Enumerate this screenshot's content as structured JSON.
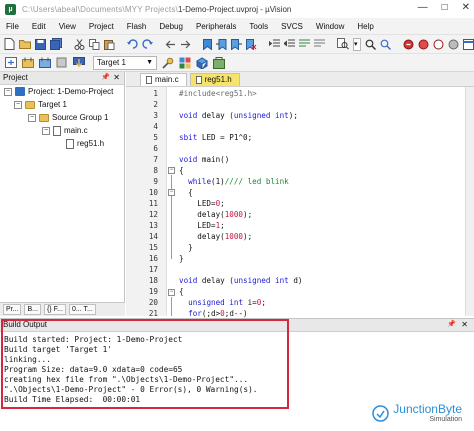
{
  "window": {
    "title_prefix": "C:\\Users\\abeal\\Documents\\MYY Projects\\",
    "title_main": "1-Demo-Project.uvproj - µVision",
    "controls": [
      "—",
      "□",
      "✕"
    ]
  },
  "menu": [
    "File",
    "Edit",
    "View",
    "Project",
    "Flash",
    "Debug",
    "Peripherals",
    "Tools",
    "SVCS",
    "Window",
    "Help"
  ],
  "toolbar": {
    "target": "Target 1"
  },
  "project_panel": {
    "title": "Project",
    "tree": {
      "project": "Project: 1-Demo-Project",
      "target": "Target 1",
      "group": "Source Group 1",
      "file1": "main.c",
      "file2": "reg51.h"
    },
    "tabs": [
      "Pr...",
      "B...",
      "{} F...",
      "0... T..."
    ]
  },
  "editor": {
    "tabs": [
      "main.c",
      "reg51.h"
    ],
    "line_numbers": [
      "1",
      "2",
      "3",
      "4",
      "5",
      "6",
      "7",
      "8",
      "9",
      "10",
      "11",
      "12",
      "13",
      "14",
      "15",
      "16",
      "17",
      "18",
      "19",
      "20",
      "21"
    ]
  },
  "build_output": {
    "title": "Build Output",
    "lines": [
      "Build started: Project: 1-Demo-Project",
      "Build target 'Target 1'",
      "linking...",
      "Program Size: data=9.0 xdata=0 code=65",
      "creating hex file from \".\\Objects\\1-Demo-Project\"...",
      "\".\\Objects\\1-Demo-Project\" - 0 Error(s), 0 Warning(s).",
      "Build Time Elapsed:  00:00:01"
    ]
  },
  "watermark": {
    "name": "JunctionByte",
    "sub": "Simulation"
  },
  "colors": {
    "highlight": "#d7263d",
    "keyword": "#1a1ad6",
    "comment": "#1f8a35",
    "active_tab": "#f6e36a"
  }
}
